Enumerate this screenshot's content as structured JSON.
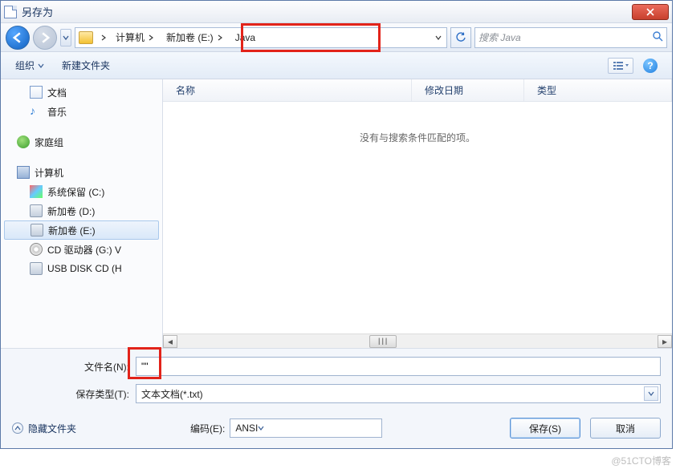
{
  "window": {
    "title": "另存为"
  },
  "nav": {
    "refresh": "↻",
    "search_placeholder": "搜索 Java"
  },
  "breadcrumb": {
    "root": "计算机",
    "drive": "新加卷 (E:)",
    "folder": "Java"
  },
  "toolbar": {
    "organize": "组织",
    "newfolder": "新建文件夹",
    "help": "?"
  },
  "columns": {
    "name": "名称",
    "date": "修改日期",
    "type": "类型"
  },
  "content": {
    "empty": "没有与搜索条件匹配的项。"
  },
  "sidebar": {
    "docs": "文档",
    "music": "音乐",
    "homegroup": "家庭组",
    "computer": "计算机",
    "driveC": "系统保留 (C:)",
    "driveD": "新加卷 (D:)",
    "driveE": "新加卷 (E:)",
    "driveG": "CD 驱动器 (G:) V",
    "usb": "USB DISK CD (H"
  },
  "form": {
    "filename_label": "文件名(N):",
    "filename_value": "\"\"",
    "filetype_label": "保存类型(T):",
    "filetype_value": "文本文档(*.txt)",
    "encoding_label": "编码(E):",
    "encoding_value": "ANSI",
    "hide_folders": "隐藏文件夹",
    "save": "保存(S)",
    "cancel": "取消"
  },
  "scrollbar": {
    "thumb": "III"
  },
  "watermark": "@51CTO博客"
}
